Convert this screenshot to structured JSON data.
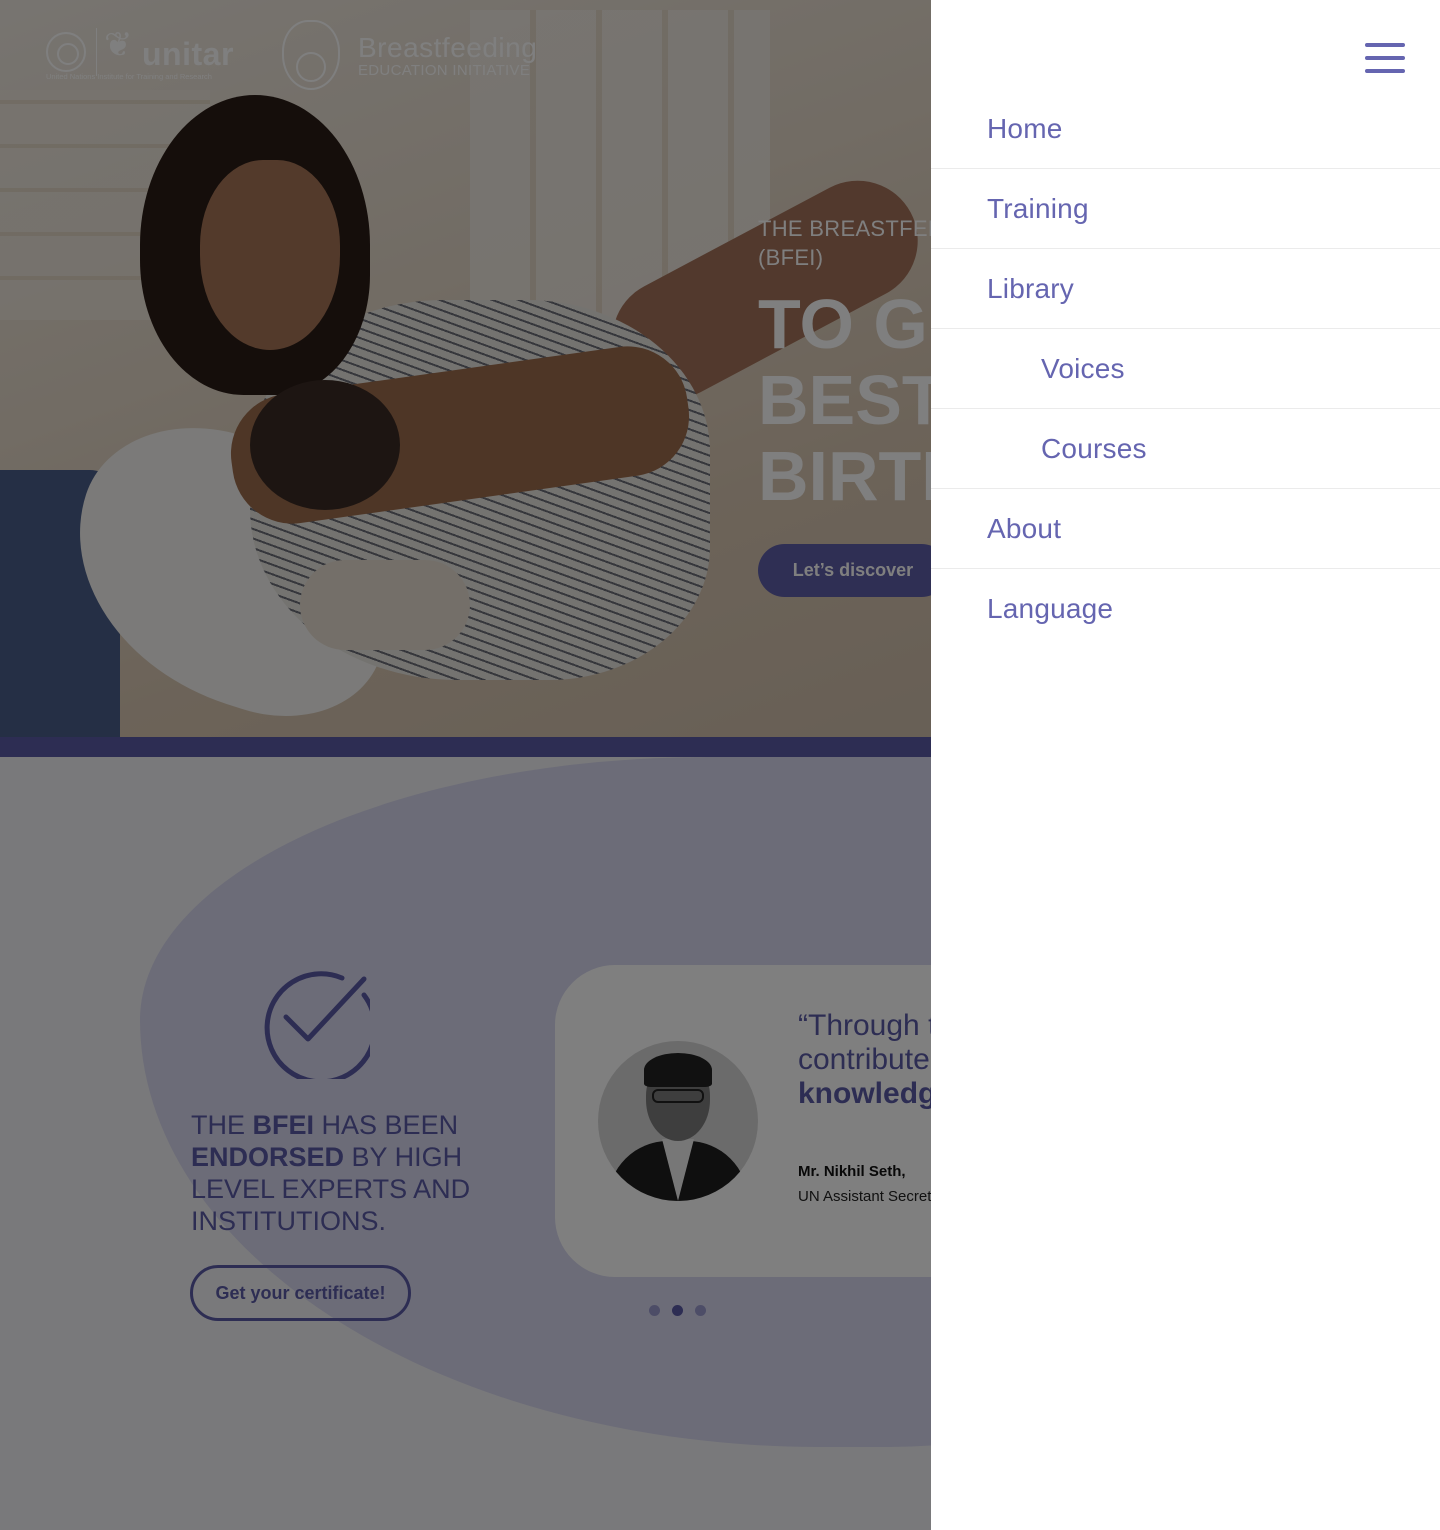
{
  "header": {
    "unitar_logo": {
      "wordmark": "unitar",
      "tagline": "United Nations Institute for Training and Research"
    },
    "bfei_logo": {
      "title": "Breastfeeding",
      "subtitle": "EDUCATION INITIATIVE"
    }
  },
  "hero": {
    "kicker": "THE BREASTFEEDING EDUCATION INITIATIVE (BFEI)",
    "headline": "TO GIVE THE BEST START AT BIRTH",
    "cta_label": "Let’s discover"
  },
  "endorsement": {
    "text_prefix": "The ",
    "text_bfei": "BFEI",
    "text_middle": " has been ",
    "text_endorsed": "endorsed",
    "text_suffix": " by high level experts and institutions.",
    "cert_button_label": "Get your certificate!"
  },
  "testimonial": {
    "quote_start": "“Through the BFEI, UNITAR aims to contribute to women’s ",
    "quote_bold": "breastfeeding knowledge",
    "quote_end": "",
    "name": "Mr. Nikhil Seth,",
    "role": "UN Assistant Secretary-General, UNITAR Executive Director",
    "carousel": {
      "count": 3,
      "active_index": 1
    }
  },
  "menu": {
    "toggle_icon": "hamburger-menu-icon",
    "items": [
      {
        "label": "Home",
        "level": 0
      },
      {
        "label": "Training",
        "level": 0
      },
      {
        "label": "Library",
        "level": 0
      },
      {
        "label": "Voices",
        "level": 1
      },
      {
        "label": "Courses",
        "level": 1
      },
      {
        "label": "About",
        "level": 0
      },
      {
        "label": "Language",
        "level": 0
      }
    ]
  },
  "colors": {
    "accent": "#6565b0",
    "accent_dark": "#5a5aa6",
    "blob": "#d8d8f0",
    "overlay": "rgba(0,0,0,0.5)",
    "menu_bg": "#ffffff"
  }
}
